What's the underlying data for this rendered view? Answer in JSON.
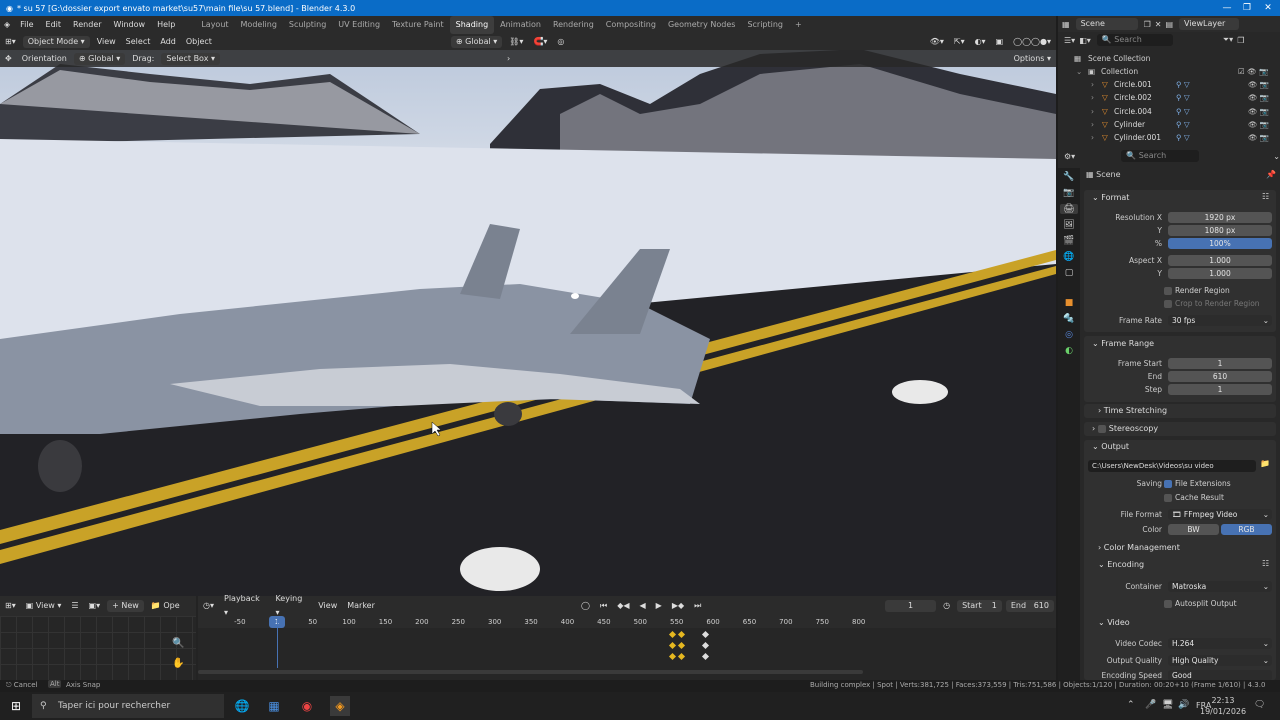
{
  "window": {
    "title": "* su 57 [G:\\dossier export envato market\\su57\\main file\\su 57.blend] - Blender 4.3.0",
    "controls": [
      "—",
      "❐",
      "✕"
    ]
  },
  "menu": {
    "items": [
      "File",
      "Edit",
      "Render",
      "Window",
      "Help"
    ],
    "workspaces": [
      "Layout",
      "Modeling",
      "Sculpting",
      "UV Editing",
      "Texture Paint",
      "Shading",
      "Animation",
      "Rendering",
      "Compositing",
      "Geometry Nodes",
      "Scripting"
    ],
    "active_workspace": "Shading",
    "add_tab": "+"
  },
  "viewport_header": {
    "mode": "Object Mode",
    "menus": [
      "View",
      "Select",
      "Add",
      "Object"
    ],
    "transform": "Global"
  },
  "tool_header": {
    "orientation_label": "Orientation",
    "orientation_value": "Global",
    "drag_label": "Drag:",
    "drag_value": "Select Box",
    "options": "Options"
  },
  "top_right": {
    "scene": "Scene",
    "view_layer": "ViewLayer"
  },
  "outliner": {
    "search_placeholder": "Search",
    "root": "Scene Collection",
    "collection": "Collection",
    "items": [
      {
        "name": "Circle.001"
      },
      {
        "name": "Circle.002"
      },
      {
        "name": "Circle.004"
      },
      {
        "name": "Cylinder"
      },
      {
        "name": "Cylinder.001"
      }
    ]
  },
  "properties": {
    "search_placeholder": "Search",
    "context": "Scene",
    "format": {
      "title": "Format",
      "res_x_label": "Resolution X",
      "res_x": "1920 px",
      "res_y_label": "Y",
      "res_y": "1080 px",
      "pct_label": "%",
      "pct": "100%",
      "aspect_x_label": "Aspect X",
      "aspect_x": "1.000",
      "aspect_y_label": "Y",
      "aspect_y": "1.000",
      "render_region": "Render Region",
      "crop": "Crop to Render Region",
      "frame_rate_label": "Frame Rate",
      "frame_rate": "30 fps"
    },
    "frame_range": {
      "title": "Frame Range",
      "start_label": "Frame Start",
      "start": "1",
      "end_label": "End",
      "end": "610",
      "step_label": "Step",
      "step": "1"
    },
    "time_stretching": "Time Stretching",
    "stereoscopy": "Stereoscopy",
    "output": {
      "title": "Output",
      "path": "C:\\Users\\NewDesk\\Videos\\su video",
      "saving_label": "Saving",
      "file_ext": "File Extensions",
      "cache": "Cache Result",
      "format_label": "File Format",
      "format": "FFmpeg Video",
      "color_label": "Color",
      "bw": "BW",
      "rgb": "RGB"
    },
    "color_management": "Color Management",
    "encoding": {
      "title": "Encoding",
      "container_label": "Container",
      "container": "Matroska",
      "autosplit": "Autosplit Output"
    },
    "video": {
      "title": "Video",
      "codec_label": "Video Codec",
      "codec": "H.264",
      "quality_label": "Output Quality",
      "quality": "High Quality",
      "speed_label": "Encoding Speed",
      "speed": "Good"
    }
  },
  "timeline": {
    "left": {
      "view": "View",
      "new": "New",
      "open": "Ope"
    },
    "menus": [
      "Playback",
      "Keying",
      "View",
      "Marker"
    ],
    "current_frame": "1",
    "start_label": "Start",
    "start": "1",
    "end_label": "End",
    "end": "610",
    "ruler": [
      "-50",
      "1",
      "50",
      "100",
      "150",
      "200",
      "250",
      "300",
      "350",
      "400",
      "450",
      "500",
      "550",
      "600",
      "650",
      "700",
      "750",
      "800"
    ]
  },
  "status": {
    "cancel": "Cancel",
    "alt": "Alt",
    "axis_snap": "Axis Snap",
    "stats": "Building complex | Spot | Verts:381,725 | Faces:373,559 | Tris:751,586 | Objects:1/120 | Duration: 00:20+10 (Frame 1/610) | 4.3.0"
  },
  "taskbar": {
    "search_placeholder": "Taper ici pour rechercher",
    "lang": "FRA",
    "time": "22:13",
    "date": "19/01/2026"
  },
  "colors": {
    "accent": "#4772b3",
    "title_bar": "#0a6cc7",
    "object_orange": "#e8902e",
    "key_yellow": "#e6b820"
  }
}
